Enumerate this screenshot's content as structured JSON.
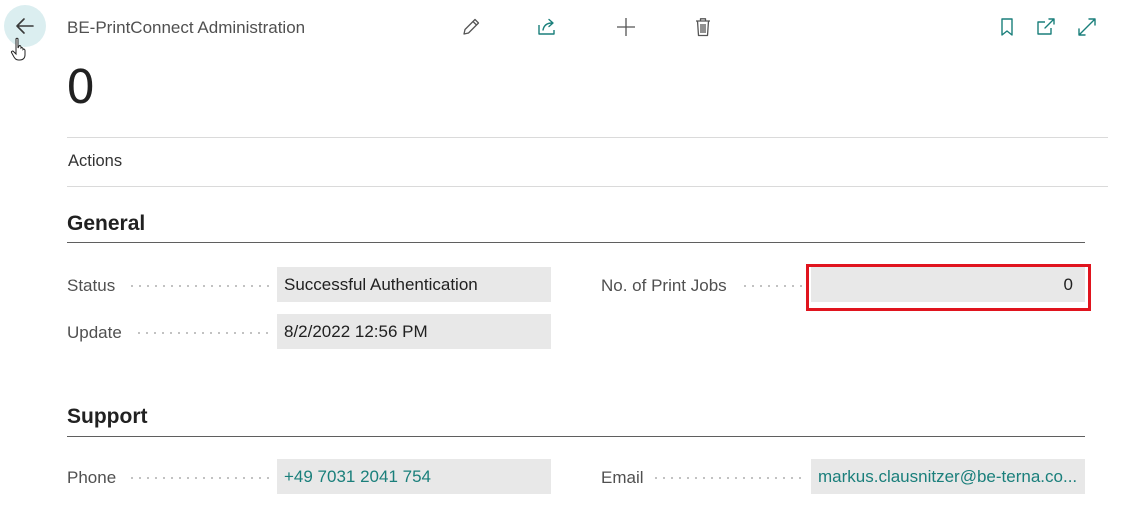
{
  "header": {
    "caption": "BE-PrintConnect Administration",
    "record_title": "0"
  },
  "actions": {
    "label": "Actions"
  },
  "general": {
    "title": "General",
    "status": {
      "label": "Status",
      "value": "Successful Authentication"
    },
    "update": {
      "label": "Update",
      "value": "8/2/2022 12:56 PM"
    },
    "print_jobs": {
      "label": "No. of Print Jobs",
      "value": "0"
    }
  },
  "support": {
    "title": "Support",
    "phone": {
      "label": "Phone",
      "value": "+49 7031 2041 754"
    },
    "email": {
      "label": "Email",
      "value": "markus.clausnitzer@be-terna.co..."
    }
  },
  "colors": {
    "accent": "#1a7f7b",
    "field_bg": "#e8e8e8",
    "highlight": "#e0141e"
  }
}
